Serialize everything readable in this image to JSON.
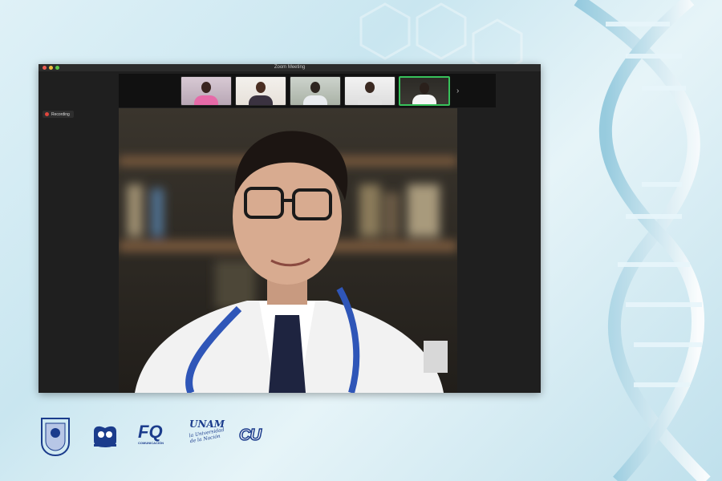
{
  "window": {
    "title": "Zoom Meeting",
    "recording_label": "Recording"
  },
  "participants": [
    {
      "name": "participant-1",
      "active": false
    },
    {
      "name": "participant-2",
      "active": false
    },
    {
      "name": "participant-3",
      "active": false
    },
    {
      "name": "participant-4",
      "active": false
    },
    {
      "name": "participant-5",
      "active": true
    }
  ],
  "icons": {
    "next": "chevron-right-icon",
    "record": "record-dot-icon"
  },
  "logos": {
    "fq_text": "FQ",
    "fq_sub": "COMUNICACIÓN",
    "unam_text": "UNAM",
    "unam_sub": "la Universidad de la Nación",
    "cu_text": "CU"
  },
  "colors": {
    "active_border": "#38c25b",
    "logo_blue": "#1b3c8c",
    "record_red": "#e0463d"
  }
}
